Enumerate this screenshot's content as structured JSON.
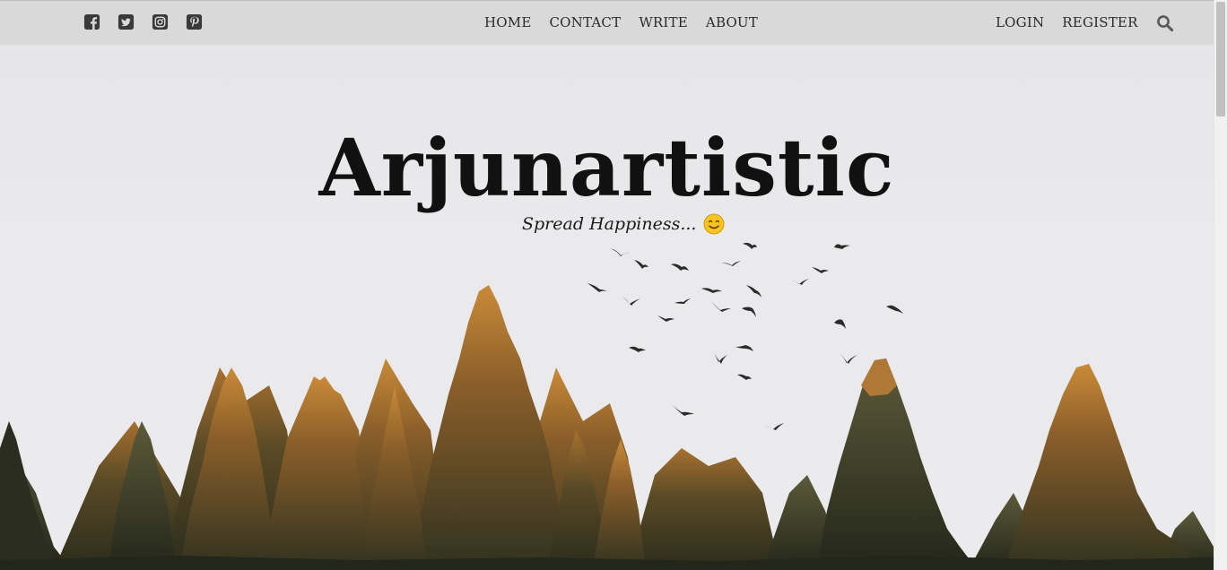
{
  "social": [
    {
      "name": "facebook-icon"
    },
    {
      "name": "twitter-icon"
    },
    {
      "name": "instagram-icon"
    },
    {
      "name": "pinterest-icon"
    }
  ],
  "nav": {
    "home": "HOME",
    "contact": "CONTACT",
    "write": "WRITE",
    "about": "ABOUT",
    "login": "LOGIN",
    "register": "REGISTER"
  },
  "hero": {
    "title": "Arjunartistic",
    "tagline": "Spread Happiness..."
  },
  "colors": {
    "topbar": "#d9d9d9",
    "sky": "#e9e9eb",
    "tree_dark": "#3a3a26",
    "tree_light": "#c98a38"
  }
}
